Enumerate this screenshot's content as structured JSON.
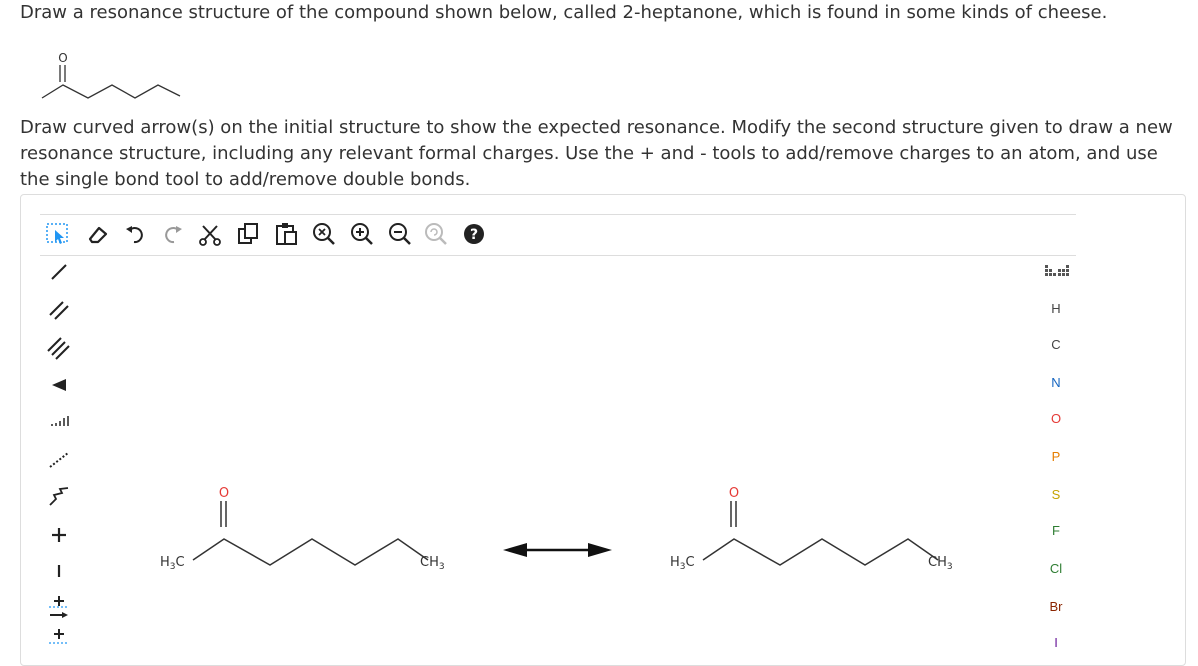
{
  "question": {
    "line1": "Draw a resonance structure of the compound shown below, called 2-heptanone, which is found in some kinds of cheese.",
    "line2": "Draw curved arrow(s) on the initial structure to show the expected resonance. Modify the second structure given to draw a new resonance structure, including any relevant formal charges. Use the + and - tools to add/remove charges to an atom, and use the single bond tool to add/remove double bonds."
  },
  "preview_molecule": {
    "oxygen_label": "O"
  },
  "toolbar": {
    "items": [
      "select-tool",
      "eraser",
      "undo",
      "redo",
      "cut",
      "copy",
      "paste",
      "zoom-reset",
      "zoom-in",
      "zoom-out",
      "clean",
      "help"
    ]
  },
  "left_tools": [
    "single-bond",
    "double-bond",
    "triple-bond",
    "wedge-bond",
    "hash-bond",
    "dashed-bond",
    "chain",
    "plus-charge",
    "minus-charge",
    "add-charge-arrow",
    "plus-charge-dotted"
  ],
  "atoms": [
    "H",
    "C",
    "N",
    "O",
    "P",
    "S",
    "F",
    "Cl",
    "Br",
    "I"
  ],
  "structure1": {
    "o_label": "O",
    "left_label": "H3C",
    "right_label": "CH3"
  },
  "structure2": {
    "o_label": "O",
    "left_label": "H3C",
    "right_label": "CH3"
  },
  "colors": {
    "oxygen": "#e53935",
    "border": "#dddddd",
    "text": "#333333"
  }
}
